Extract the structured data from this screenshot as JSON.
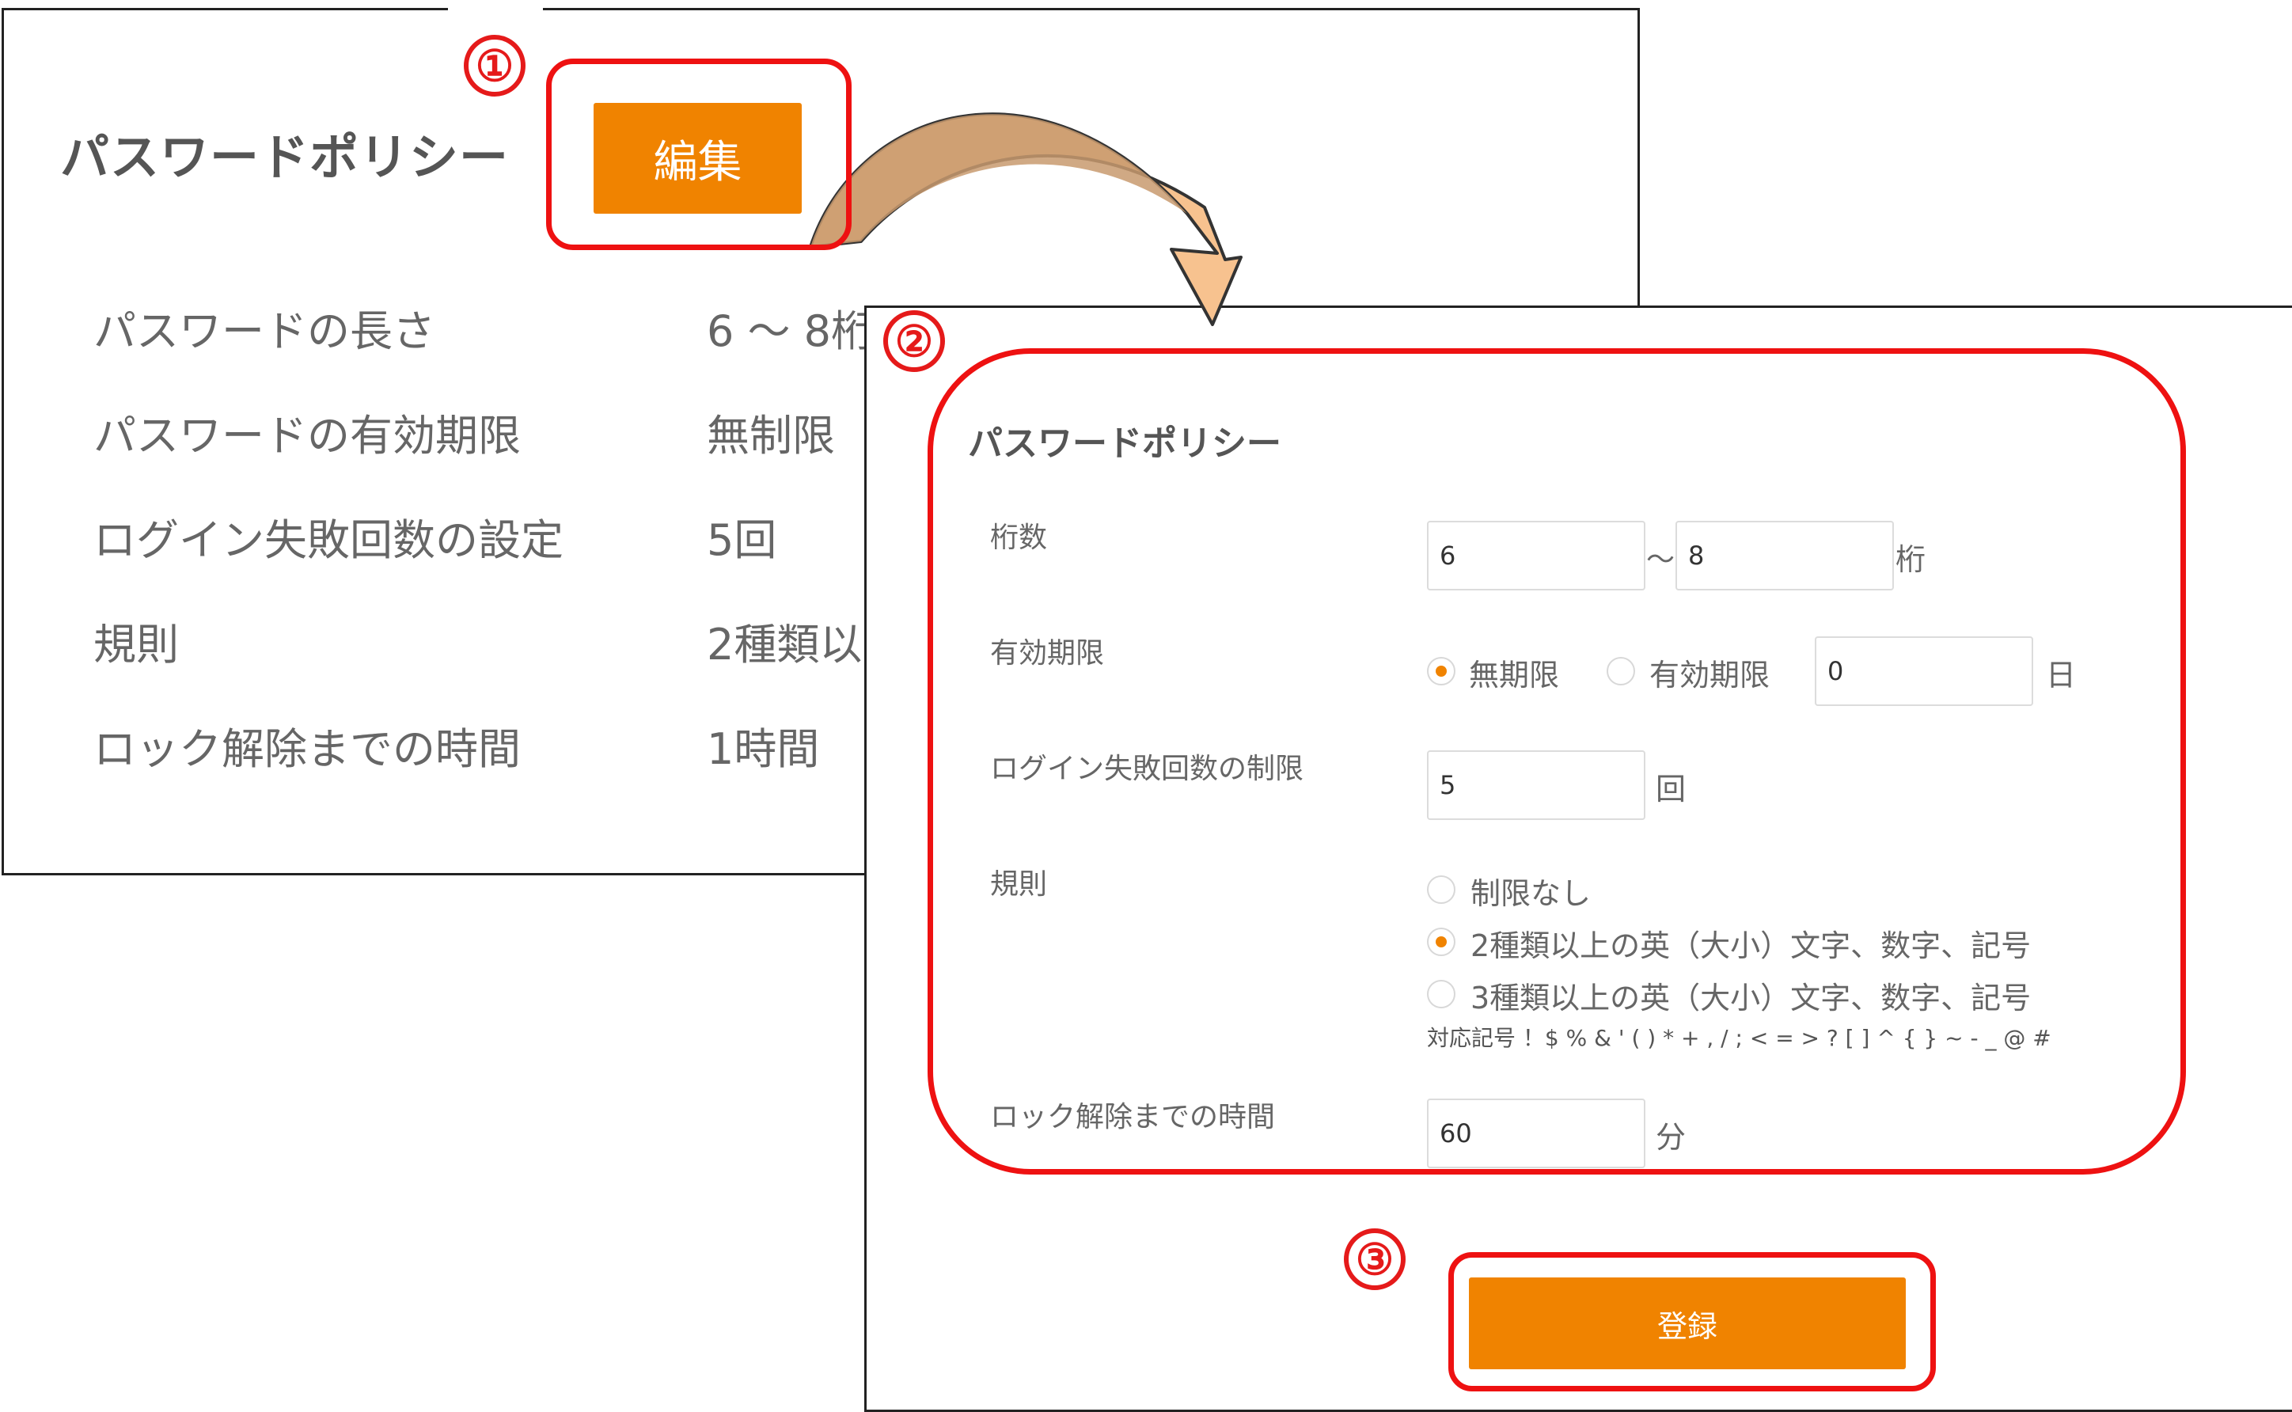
{
  "view": {
    "title": "パスワードポリシー",
    "edit_label": "編集",
    "rows": [
      {
        "label": "パスワードの長さ",
        "value": "6 ～ 8桁"
      },
      {
        "label": "パスワードの有効期限",
        "value": "無制限"
      },
      {
        "label": "ログイン失敗回数の設定",
        "value": "5回"
      },
      {
        "label": "規則",
        "value": "2種類以"
      },
      {
        "label": "ロック解除までの時間",
        "value": "1時間"
      }
    ]
  },
  "form": {
    "title": "パスワードポリシー",
    "digits": {
      "label": "桁数",
      "min": "6",
      "separator": "～",
      "max": "8",
      "unit": "桁"
    },
    "expiry": {
      "label": "有効期限",
      "option_unlimited": "無期限",
      "option_limited": "有効期限",
      "value": "0",
      "unit": "日",
      "selected": "無期限"
    },
    "login_fail": {
      "label": "ログイン失敗回数の制限",
      "value": "5",
      "unit": "回"
    },
    "rules": {
      "label": "規則",
      "options": [
        "制限なし",
        "2種類以上の英（大小）文字、数字、記号",
        "3種類以上の英（大小）文字、数字、記号"
      ],
      "selected": "2種類以上の英（大小）文字、数字、記号",
      "symbols": "対応記号 ！$ % & ' ( ) * + , / ; < = > ? [ ] ^ { } ~ - _ @ #"
    },
    "unlock": {
      "label": "ロック解除までの時間",
      "value": "60",
      "unit": "分"
    },
    "submit_label": "登録"
  },
  "steps": [
    "①",
    "②",
    "③"
  ],
  "colors": {
    "accent": "#f08300",
    "highlight": "#ee1111",
    "arrow": "#f7c28f"
  }
}
